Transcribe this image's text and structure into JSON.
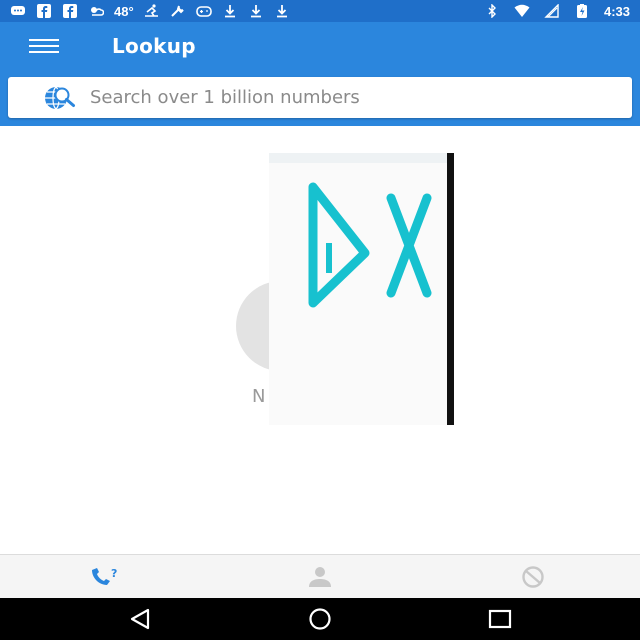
{
  "status_bar": {
    "temperature": "48°",
    "time": "4:33",
    "left_icons": [
      "chat-icon",
      "facebook-icon",
      "facebook-icon",
      "weather-icon",
      "skater-icon",
      "wrench-icon",
      "gamepad-icon",
      "download-icon",
      "download-icon",
      "download-icon"
    ],
    "right_icons": [
      "bluetooth-icon",
      "wifi-icon",
      "signal-icon",
      "battery-icon"
    ]
  },
  "app_bar": {
    "title": "Lookup",
    "search": {
      "placeholder": "Search over 1 billion numbers",
      "value": ""
    }
  },
  "content": {
    "empty_state_text": "N"
  },
  "bottom_tabs": [
    {
      "icon": "phone-lookup-icon",
      "selected": true
    },
    {
      "icon": "contact-icon",
      "selected": false
    },
    {
      "icon": "block-icon",
      "selected": false
    }
  ],
  "colors": {
    "status_bar": "#1f6fc9",
    "app_bar": "#2b86dd",
    "accent": "#2b86dd",
    "overlay_glyph": "#17c1cf",
    "inactive_icon": "#c8c8c8"
  }
}
